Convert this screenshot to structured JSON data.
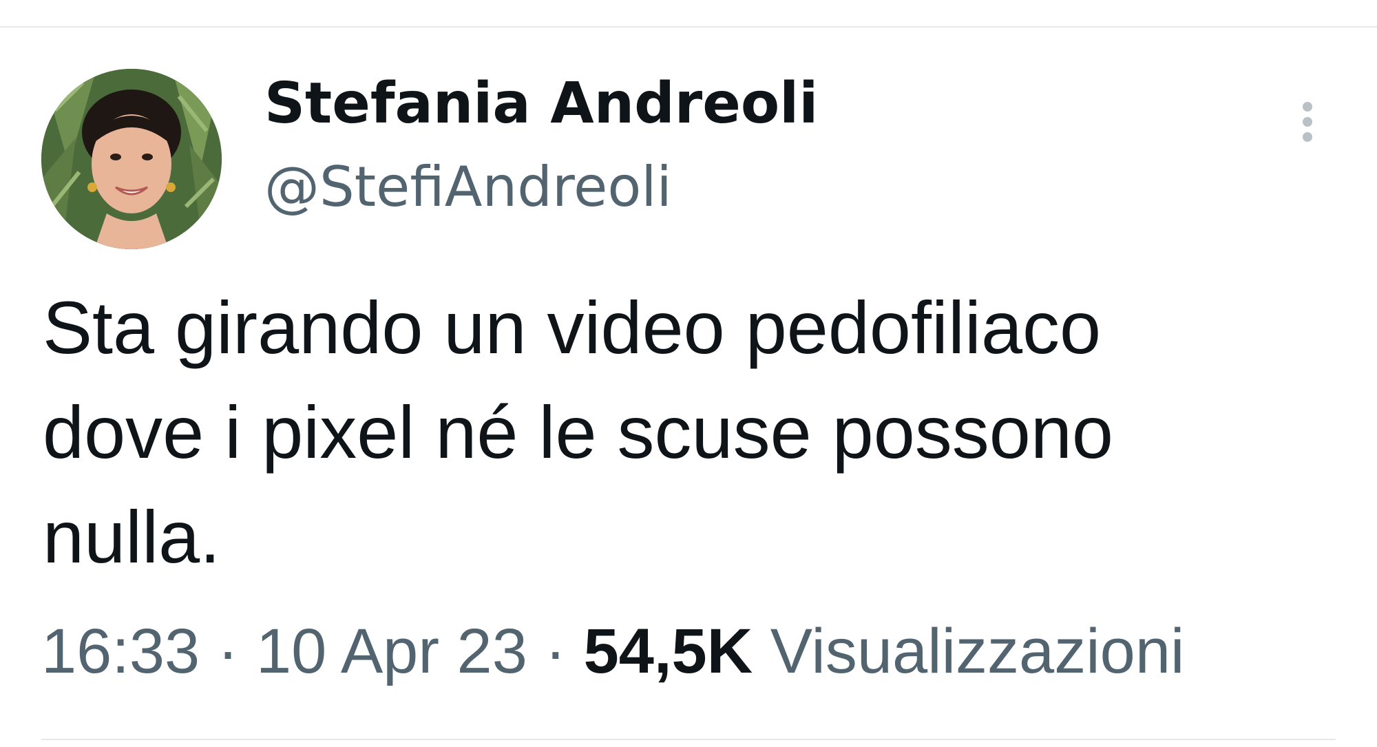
{
  "author": {
    "display_name": "Stefania Andreoli",
    "handle": "@StefiAndreoli"
  },
  "tweet": {
    "text_lines": [
      "Sta girando un video pedofiliaco",
      "dove i pixel né le scuse possono",
      "nulla."
    ],
    "time": "16:33",
    "separator": "·",
    "date": "10 Apr 23",
    "views_count": "54,5K",
    "views_label": "Visualizzazioni"
  },
  "icons": {
    "more": "more-vertical-icon"
  },
  "colors": {
    "text_primary": "#0f1419",
    "text_secondary": "#536471",
    "divider": "#e6e9eb"
  }
}
